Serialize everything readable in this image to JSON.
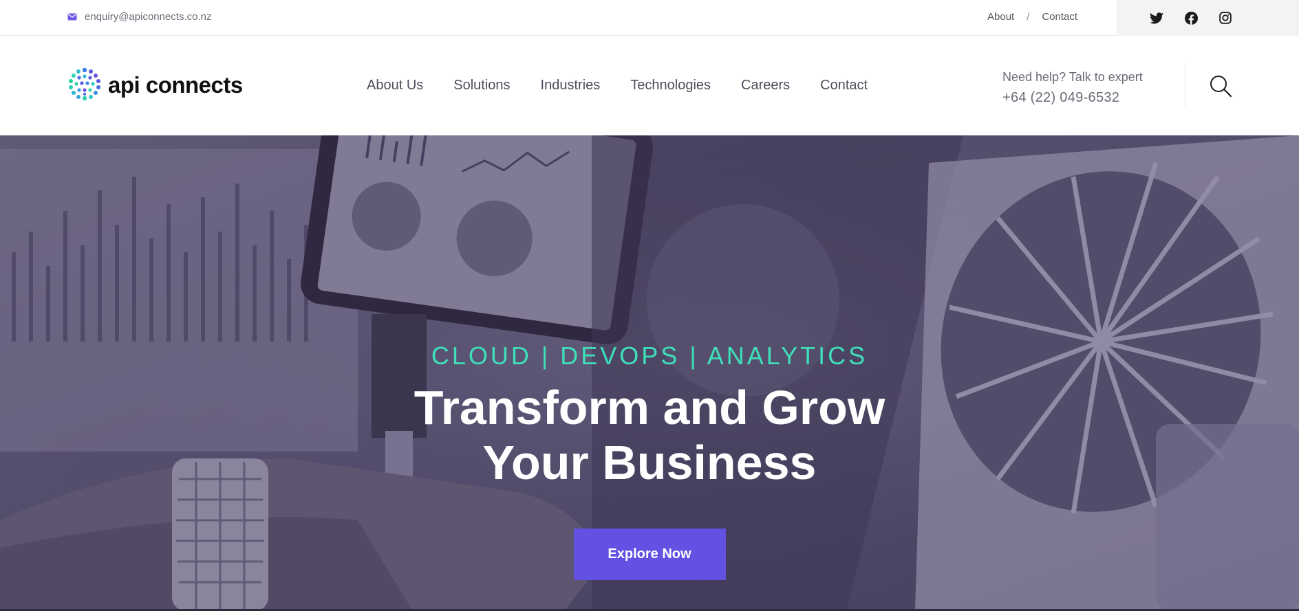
{
  "topbar": {
    "email": "enquiry@apiconnects.co.nz",
    "links": {
      "about": "About",
      "separator": "/",
      "contact": "Contact"
    },
    "socials": [
      "twitter-icon",
      "facebook-icon",
      "instagram-icon"
    ]
  },
  "header": {
    "logo_text": "api connects",
    "nav": [
      "About Us",
      "Solutions",
      "Industries",
      "Technologies",
      "Careers",
      "Contact"
    ],
    "help_label": "Need help? Talk to expert",
    "help_phone": "+64 (22) 049-6532"
  },
  "hero": {
    "tagline": "CLOUD | DEVOPS | ANALYTICS",
    "title_line1": "Transform and Grow",
    "title_line2": "Your Business",
    "cta_label": "Explore Now"
  },
  "colors": {
    "accent": "#6351e3",
    "tagline": "#3fe0b8",
    "text_muted": "#6b6b78"
  }
}
